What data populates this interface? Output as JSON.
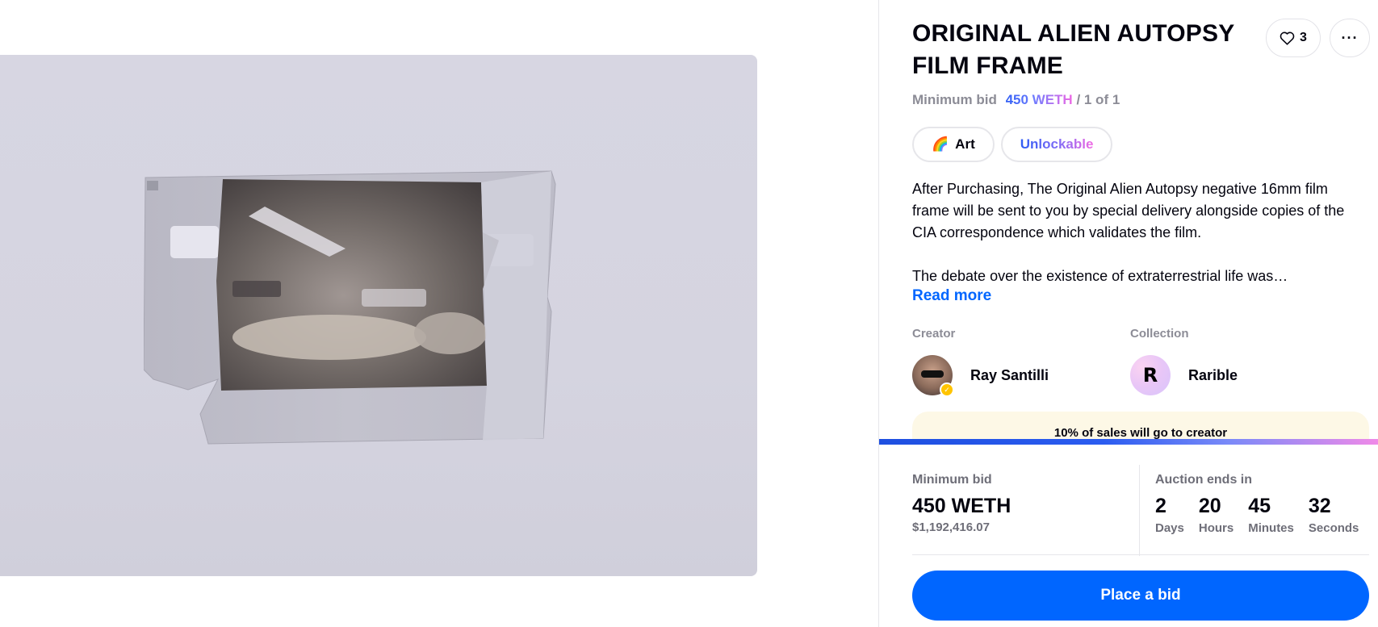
{
  "nft": {
    "title": "ORIGINAL ALIEN AUTOPSY FILM FRAME",
    "likes": "3",
    "more_label": "···",
    "price_label": "Minimum bid",
    "price_value": "450 WETH",
    "edition": "/ 1 of 1",
    "image_alt": "Alien autopsy negative film frame"
  },
  "tags": [
    {
      "emoji": "🌈",
      "label": "Art"
    },
    {
      "label": "Unlockable"
    }
  ],
  "description": {
    "paragraph_1": "After Purchasing, The Original Alien Autopsy negative 16mm film frame will be sent to you by special delivery alongside copies of the CIA correspondence which validates the film.",
    "paragraph_2": "The debate over the existence of extraterrestrial life was…",
    "read_more": "Read more"
  },
  "creator": {
    "label": "Creator",
    "name": "Ray Santilli"
  },
  "collection": {
    "label": "Collection",
    "name": "Rarible",
    "logo_letter": "R"
  },
  "royalty": {
    "text": "10% of sales will go to creator"
  },
  "bid": {
    "label": "Minimum bid",
    "amount": "450 WETH",
    "usd": "$1,192,416.07",
    "auction_label": "Auction ends in",
    "countdown": [
      {
        "value": "2",
        "unit": "Days"
      },
      {
        "value": "20",
        "unit": "Hours"
      },
      {
        "value": "45",
        "unit": "Minutes"
      },
      {
        "value": "32",
        "unit": "Seconds"
      }
    ],
    "button": "Place a bid"
  },
  "colors": {
    "accent": "#0066ff",
    "muted": "#8c8c96",
    "royalty_bg": "#fdf8e6"
  }
}
